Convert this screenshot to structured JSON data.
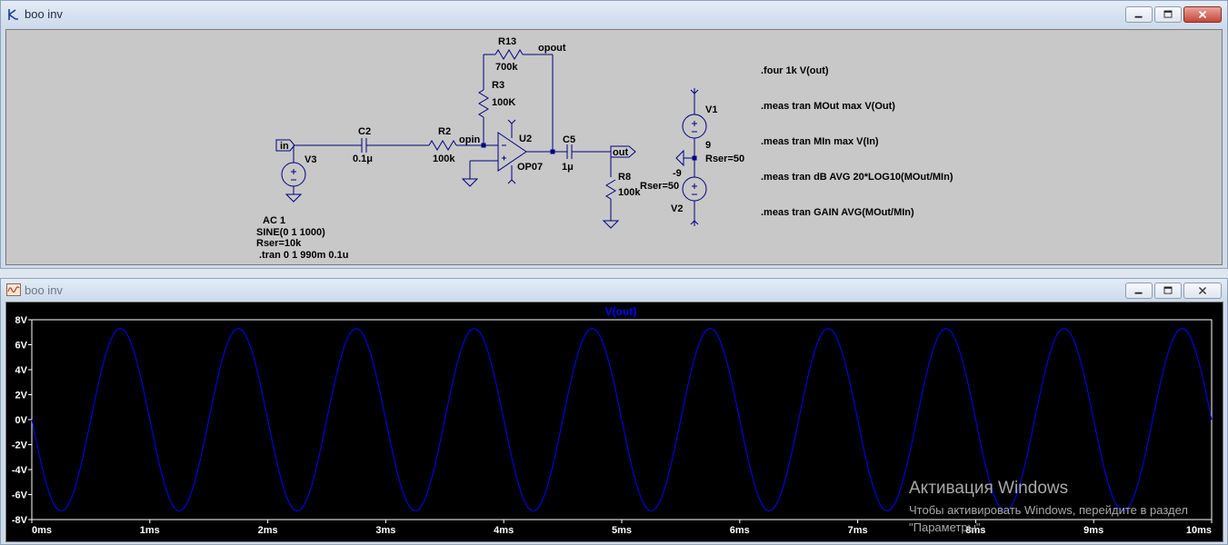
{
  "windows": {
    "schematic": {
      "title": "boo inv"
    },
    "plot": {
      "title": "boo inv"
    }
  },
  "schematic": {
    "directives": [
      ".four 1k V(out)",
      ".meas tran MOut max V(Out)",
      ".meas tran MIn max V(In)",
      ".meas tran dB AVG 20*LOG10(MOut/MIn)",
      ".meas tran GAIN AVG(MOut/MIn)"
    ],
    "source_ac": "AC 1",
    "source_sine": "SINE(0 1 1000)",
    "source_rser": "Rser=10k",
    "tran": ".tran 0 1 990m 0.1u",
    "labels": {
      "in": "in",
      "v3": "V3",
      "c2": "C2",
      "c2_val": "0.1μ",
      "r2": "R2",
      "r2_val": "100k",
      "opin": "opin",
      "r13": "R13",
      "r13_val": "700k",
      "opout": "opout",
      "r3": "R3",
      "r3_val": "100K",
      "u2": "U2",
      "op07": "OP07",
      "c5": "C5",
      "c5_val": "1μ",
      "out": "out",
      "r8": "R8",
      "r8_val": "100k",
      "v1": "V1",
      "v1_val": "9",
      "v1_rser": "Rser=50",
      "v2_val": "-9",
      "v2_rser": "Rser=50",
      "v2": "V2"
    }
  },
  "chart_data": {
    "type": "line",
    "title": "V(out)",
    "xlabel": "",
    "ylabel": "",
    "x_ticks": [
      "0ms",
      "1ms",
      "2ms",
      "3ms",
      "4ms",
      "5ms",
      "6ms",
      "7ms",
      "8ms",
      "9ms",
      "10ms"
    ],
    "y_ticks": [
      "-8V",
      "-6V",
      "-4V",
      "-2V",
      "0V",
      "2V",
      "4V",
      "6V",
      "8V"
    ],
    "xlim": [
      0,
      10
    ],
    "ylim": [
      -8,
      8
    ],
    "series": [
      {
        "name": "V(out)",
        "waveform": "sine",
        "amplitude": 7.3,
        "frequency_per_ms": 1,
        "phase_deg": 180,
        "offset": 0
      }
    ],
    "grid": false,
    "colors": {
      "background": "#000000",
      "trace": "#0000ff",
      "title": "#0000ff",
      "axis_text": "#ffffff"
    }
  },
  "watermark": {
    "line1": "Активация Windows",
    "line2": "Чтобы активировать Windows, перейдите в раздел \"Параметры\"."
  },
  "colors": {
    "wire": "#000080",
    "component": "#000080",
    "titlebar_text": "#1e2a3a"
  }
}
